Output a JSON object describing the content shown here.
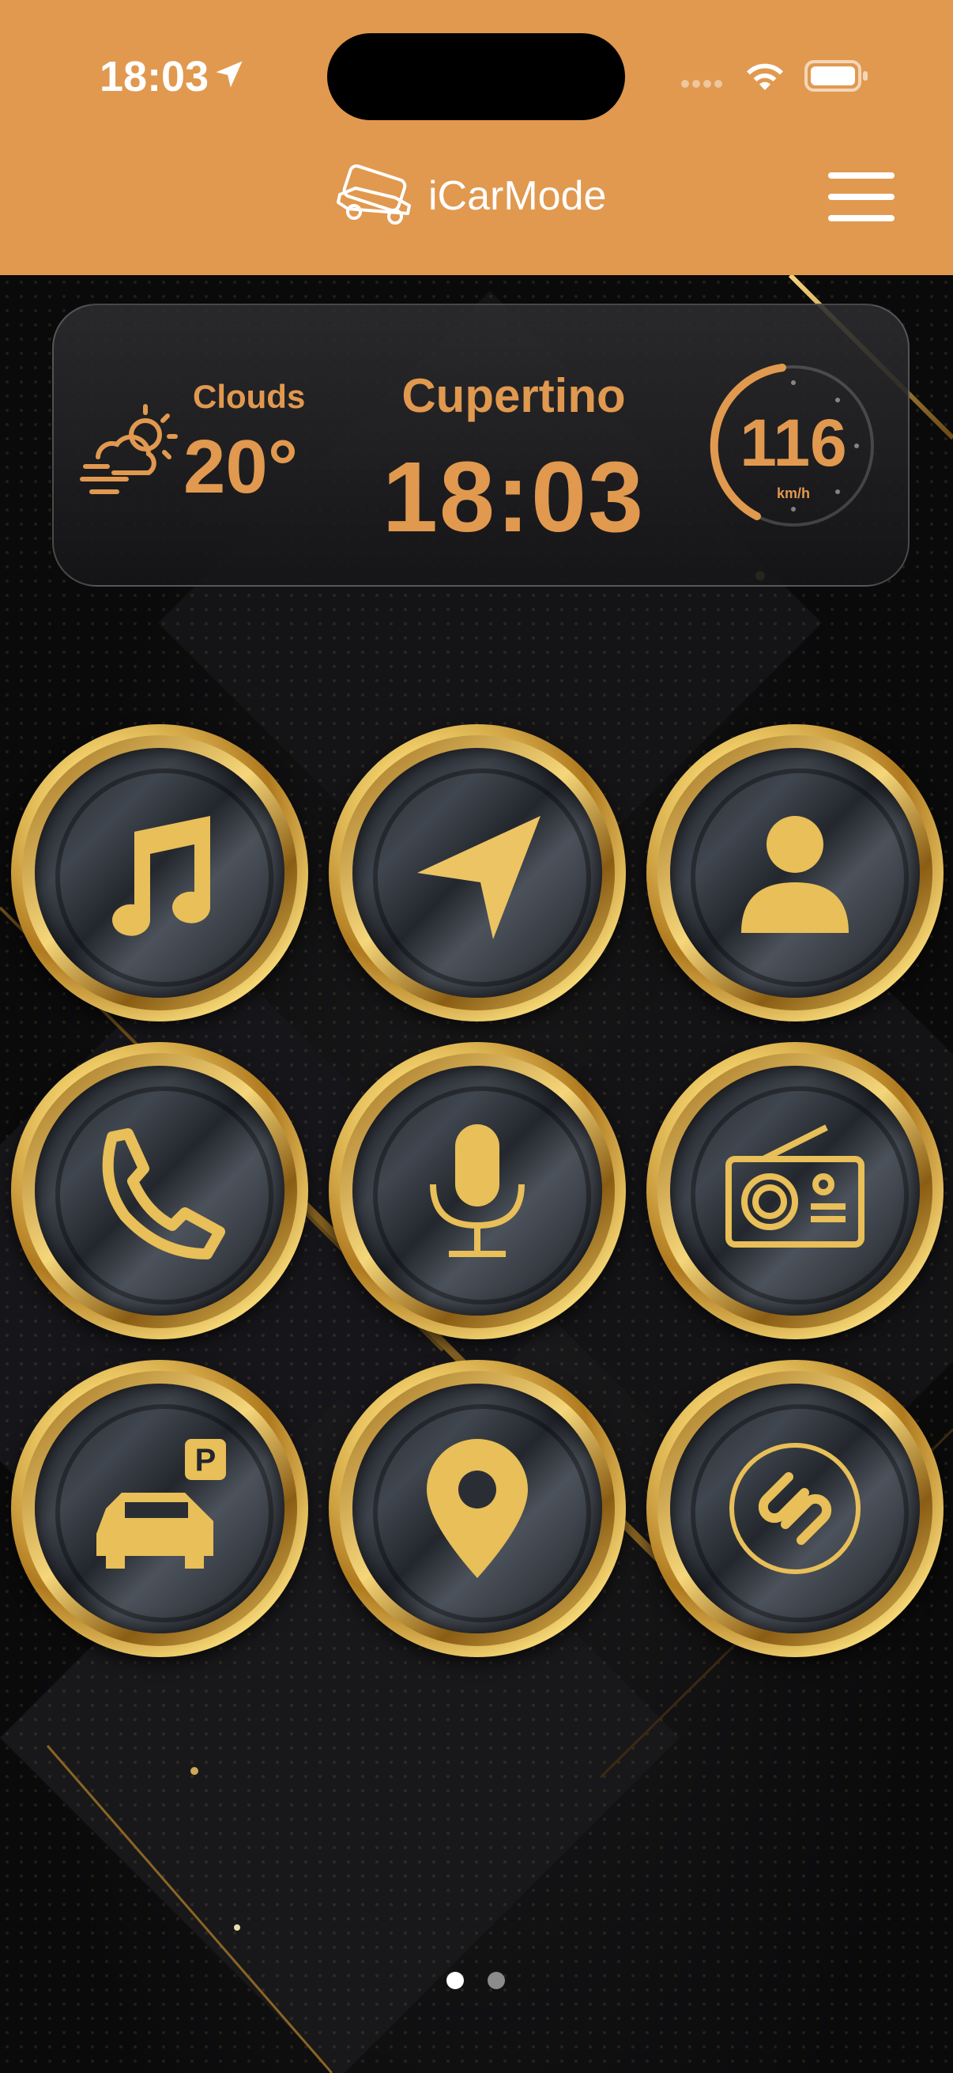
{
  "status_bar": {
    "time": "18:03",
    "icons": [
      "location-arrow-icon",
      "signal-icon",
      "wifi-icon",
      "battery-icon"
    ]
  },
  "header": {
    "title": "iCarMode",
    "logo_icon": "car-phone-logo-icon",
    "menu_icon": "hamburger-menu-icon",
    "background_color": "#e1994f"
  },
  "widget": {
    "weather": {
      "condition": "Clouds",
      "temperature": "20°",
      "icon": "cloud-sun-wind-icon"
    },
    "city": "Cupertino",
    "time": "18:03",
    "speed": {
      "value": "116",
      "unit": "km/h"
    },
    "accent_color": "#e1994f"
  },
  "apps": [
    {
      "name": "music",
      "icon": "music-note-icon"
    },
    {
      "name": "navigation",
      "icon": "navigation-arrow-icon"
    },
    {
      "name": "contacts",
      "icon": "contact-person-icon"
    },
    {
      "name": "phone",
      "icon": "phone-handset-icon"
    },
    {
      "name": "voice",
      "icon": "microphone-icon"
    },
    {
      "name": "radio",
      "icon": "radio-icon"
    },
    {
      "name": "parking",
      "icon": "car-parking-icon"
    },
    {
      "name": "location",
      "icon": "map-pin-icon"
    },
    {
      "name": "shazam",
      "icon": "shazam-icon"
    }
  ],
  "pagination": {
    "pages": 2,
    "current": 1
  },
  "colors": {
    "gold": "#e8bf58",
    "background": "#0b0b0c"
  }
}
